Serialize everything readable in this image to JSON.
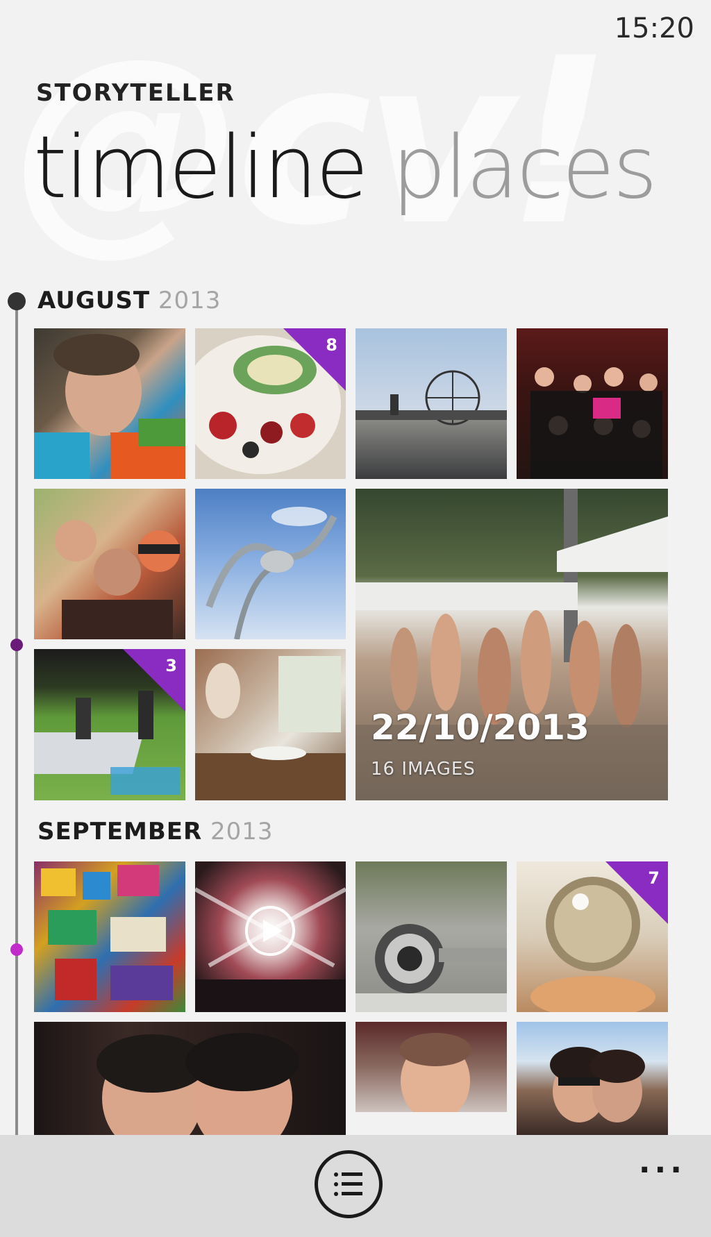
{
  "status_bar": {
    "time": "15:20"
  },
  "header": {
    "app_name": "STORYTELLER",
    "pivots": [
      {
        "label": "timeline",
        "active": true
      },
      {
        "label": "places",
        "active": false
      }
    ],
    "watermark": "@cv!"
  },
  "sections": [
    {
      "month": "AUGUST",
      "year": "2013",
      "badges": {
        "tile_2": "8",
        "tile_9": "3"
      },
      "featured": {
        "date": "22/10/2013",
        "count_label": "16 IMAGES"
      }
    },
    {
      "month": "SEPTEMBER",
      "year": "2013",
      "badges": {
        "tile_4": "7"
      }
    }
  ],
  "app_bar": {
    "primary_icon": "list-icon",
    "more_label": "..."
  },
  "colors": {
    "accent": "#8a2bc2",
    "background": "#f2f2f2",
    "app_bar": "#dcdcdc"
  }
}
